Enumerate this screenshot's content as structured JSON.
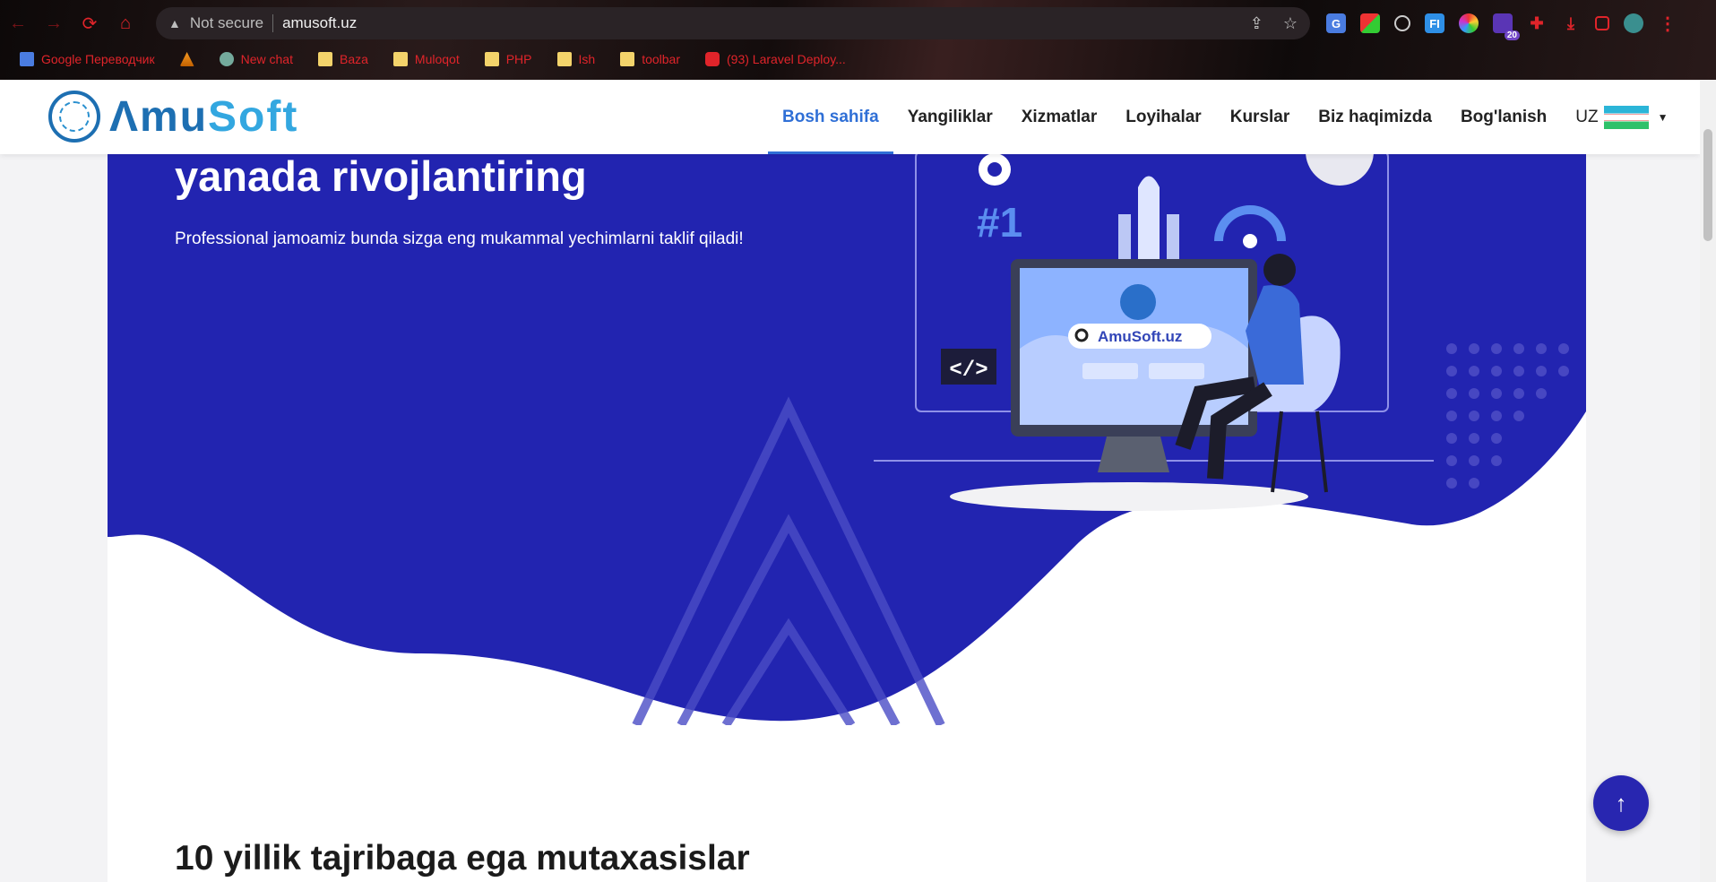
{
  "browser": {
    "security_label": "Not secure",
    "url": "amusoft.uz",
    "extension_badge": "20",
    "bookmarks": [
      {
        "label": "Google Переводчик"
      },
      {
        "label": ""
      },
      {
        "label": "New chat"
      },
      {
        "label": "Baza"
      },
      {
        "label": "Muloqot"
      },
      {
        "label": "PHP"
      },
      {
        "label": "Ish"
      },
      {
        "label": "toolbar"
      },
      {
        "label": "(93) Laravel Deploy..."
      }
    ]
  },
  "site": {
    "logo_part1": "Λmu",
    "logo_part2": "Soft",
    "nav": [
      {
        "label": "Bosh sahifa",
        "active": true
      },
      {
        "label": "Yangiliklar"
      },
      {
        "label": "Xizmatlar"
      },
      {
        "label": "Loyihalar"
      },
      {
        "label": "Kurslar"
      },
      {
        "label": "Biz haqimizda"
      },
      {
        "label": "Bog'lanish"
      }
    ],
    "language": "UZ"
  },
  "hero": {
    "title": "yanada rivojlantiring",
    "subtitle": "Professional jamoamiz bunda sizga eng mukammal yechimlarni taklif qiladi!",
    "illustration_search_text": "AmuSoft.uz",
    "illustration_rank": "#1",
    "illustration_code": "</>"
  },
  "section": {
    "title": "10 yillik tajribaga ega mutaxasislar"
  },
  "colors": {
    "hero_bg": "#2224b0",
    "accent": "#2f6fd6",
    "scroll_btn": "#2826b0"
  }
}
